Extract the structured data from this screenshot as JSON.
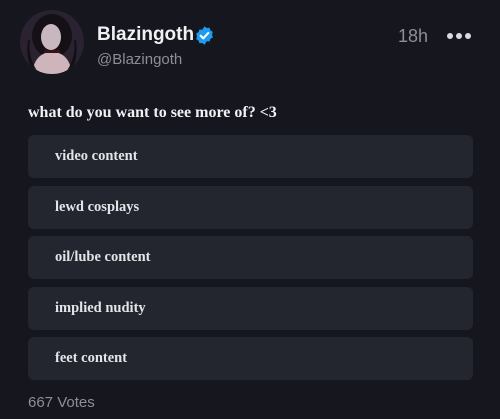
{
  "post": {
    "display_name": "Blazingoth",
    "handle": "@Blazingoth",
    "time": "18h",
    "verified_icon": "verified-badge-icon",
    "more_icon": "more-options-icon",
    "text": "what do you want to see more of? <3"
  },
  "poll": {
    "options": [
      {
        "label": "video content"
      },
      {
        "label": "lewd cosplays"
      },
      {
        "label": "oil/lube content"
      },
      {
        "label": "implied nudity"
      },
      {
        "label": "feet content"
      }
    ],
    "votes": "667 Votes"
  },
  "colors": {
    "background": "#16171e",
    "option_background": "#24262f",
    "verified": "#1d9bf0",
    "muted_text": "#8b8f99"
  }
}
